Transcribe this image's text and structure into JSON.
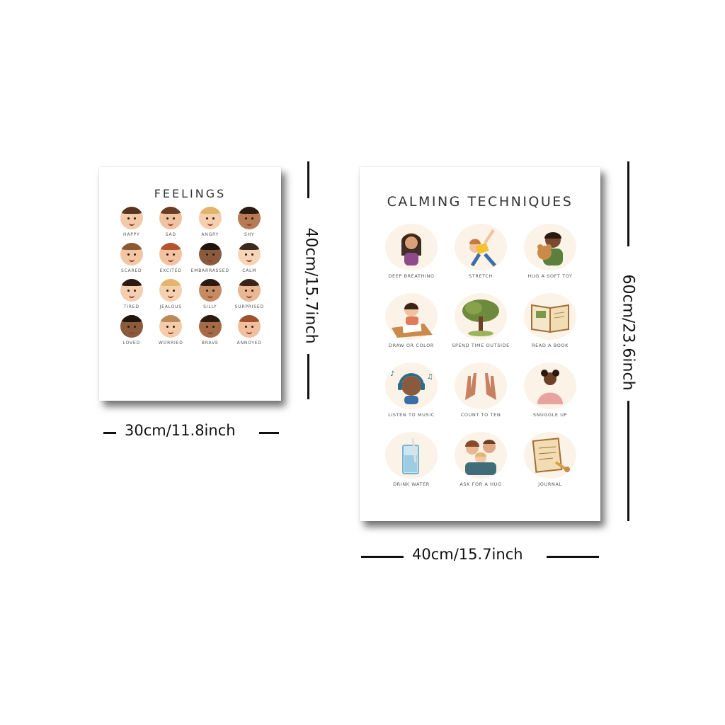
{
  "feelings_poster": {
    "title": "FEELINGS",
    "items": [
      {
        "label": "HAPPY",
        "skin": "#f3c9a8",
        "hair": "#5a3420"
      },
      {
        "label": "SAD",
        "skin": "#f0c2a0",
        "hair": "#6b3d22"
      },
      {
        "label": "ANGRY",
        "skin": "#f5cfae",
        "hair": "#e2b46a"
      },
      {
        "label": "SHY",
        "skin": "#b77a55",
        "hair": "#2a1a12"
      },
      {
        "label": "SCARED",
        "skin": "#f2c6a2",
        "hair": "#8a5a32"
      },
      {
        "label": "EXCITED",
        "skin": "#f3c2a0",
        "hair": "#b5532e"
      },
      {
        "label": "EMBARRASSED",
        "skin": "#8a5a3e",
        "hair": "#1e130e"
      },
      {
        "label": "CALM",
        "skin": "#f6d4b6",
        "hair": "#3a2a20"
      },
      {
        "label": "TIRED",
        "skin": "#f3cfb0",
        "hair": "#2a1a12"
      },
      {
        "label": "JEALOUS",
        "skin": "#f5d0ae",
        "hair": "#e4b56a"
      },
      {
        "label": "SILLY",
        "skin": "#c58c64",
        "hair": "#2a1a12"
      },
      {
        "label": "SURPRISED",
        "skin": "#e9b791",
        "hair": "#3a2419"
      },
      {
        "label": "LOVED",
        "skin": "#8c5a3c",
        "hair": "#1f140e"
      },
      {
        "label": "WORRIED",
        "skin": "#f4ccaa",
        "hair": "#b98a5c"
      },
      {
        "label": "BRAVE",
        "skin": "#a56b47",
        "hair": "#2a1a12"
      },
      {
        "label": "ANNOYED",
        "skin": "#f0c09e",
        "hair": "#a0502e"
      }
    ]
  },
  "calming_poster": {
    "title": "CALMING TECHNIQUES",
    "items": [
      {
        "label": "DEEP BREATHING",
        "icon": "girl-breathing-icon"
      },
      {
        "label": "STRETCH",
        "icon": "stretching-kid-icon"
      },
      {
        "label": "HUG A SOFT TOY",
        "icon": "teddy-hug-icon"
      },
      {
        "label": "DRAW OR COLOR",
        "icon": "drawing-kid-icon"
      },
      {
        "label": "SPEND TIME OUTSIDE",
        "icon": "tree-icon"
      },
      {
        "label": "READ A BOOK",
        "icon": "open-book-icon"
      },
      {
        "label": "LISTEN TO MUSIC",
        "icon": "headphones-kid-icon"
      },
      {
        "label": "COUNT TO TEN",
        "icon": "two-hands-icon"
      },
      {
        "label": "SNUGGLE UP",
        "icon": "blanket-kid-icon"
      },
      {
        "label": "DRINK WATER",
        "icon": "water-glass-icon"
      },
      {
        "label": "ASK FOR A HUG",
        "icon": "family-hug-icon"
      },
      {
        "label": "JOURNAL",
        "icon": "journal-pencil-icon"
      }
    ]
  },
  "dimensions": {
    "small_width": "30cm/11.8inch",
    "small_height": "40cm/15.7inch",
    "large_width": "40cm/15.7inch",
    "large_height": "60cm/23.6inch"
  }
}
